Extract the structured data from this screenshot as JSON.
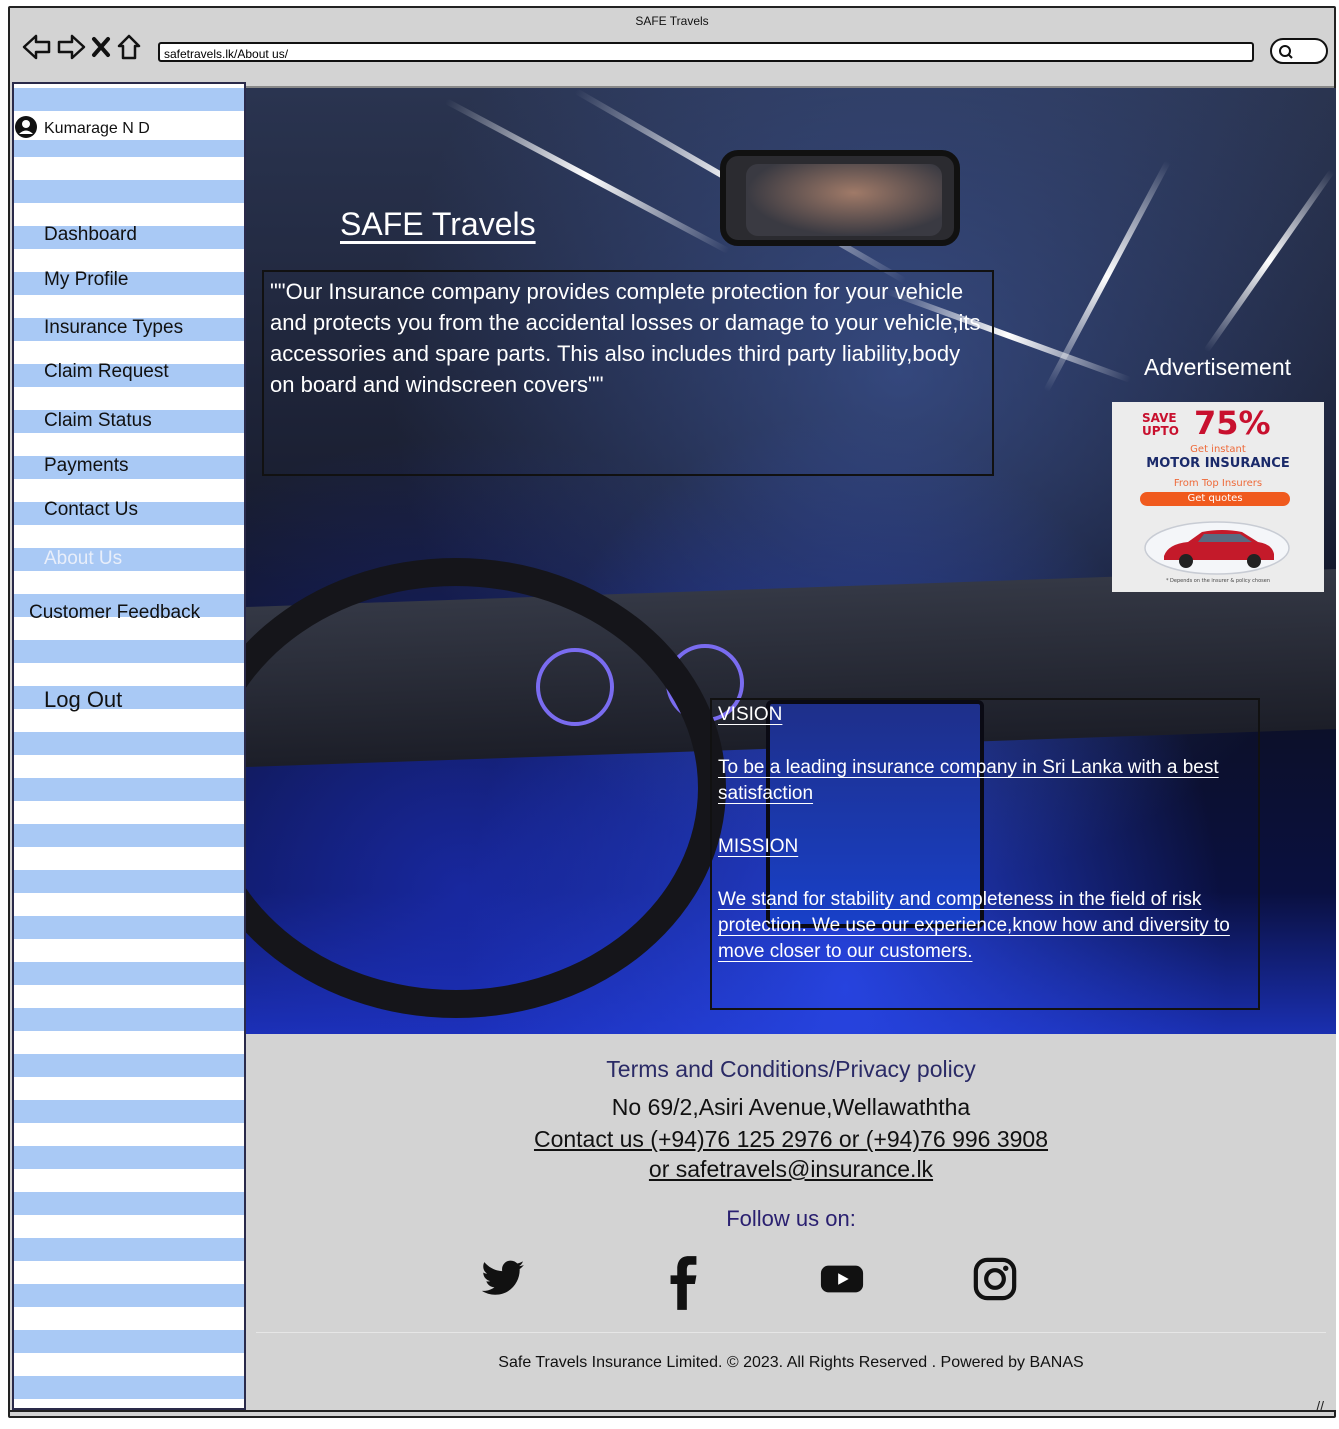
{
  "browser": {
    "title": "SAFE Travels",
    "url": "safetravels.lk/About us/",
    "icons": [
      "back-arrow-icon",
      "forward-arrow-icon",
      "close-icon",
      "home-icon",
      "search-icon"
    ]
  },
  "sidebar": {
    "user_name": "Kumarage N D",
    "items": [
      {
        "label": "Dashboard"
      },
      {
        "label": "My Profile"
      },
      {
        "label": "Insurance Types"
      },
      {
        "label": "Claim Request"
      },
      {
        "label": "Claim Status"
      },
      {
        "label": "Payments"
      },
      {
        "label": "Contact Us"
      },
      {
        "label": "About Us",
        "active": true
      },
      {
        "label": "Customer Feedback"
      },
      {
        "label": "Log Out"
      }
    ]
  },
  "hero": {
    "title": "SAFE Travels",
    "quote": "\"\"Our Insurance company provides complete protection for your vehicle and protects you from the accidental losses or damage to your vehicle,its accessories and spare parts. This also includes third party liability,body on board and windscreen covers\"\""
  },
  "advertisement": {
    "label": "Advertisement",
    "save": "SAVE",
    "upto": "UPTO",
    "percent": "75%",
    "instant": "Get instant",
    "motor": "MOTOR INSURANCE",
    "from": "From Top Insurers",
    "button": "Get quotes",
    "fineprint": "* Depends on the insurer & policy chosen"
  },
  "vision_mission": {
    "vision_heading": "VISION",
    "vision_text": "To be a leading insurance company in Sri Lanka with a best satisfaction",
    "mission_heading": "MISSION",
    "mission_text": "We stand for stability and completeness in the field of risk protection. We use our experience,know how and diversity to move closer to our customers."
  },
  "footer": {
    "terms": "Terms and Conditions/Privacy policy",
    "address": "No 69/2,Asiri Avenue,Wellawaththa",
    "contact": "Contact us (+94)76 125 2976 or (+94)76 996 3908",
    "email": "or  safetravels@insurance.lk",
    "follow": "Follow us on:",
    "social": [
      "twitter-icon",
      "facebook-icon",
      "youtube-icon",
      "instagram-icon"
    ],
    "copyright": "Safe Travels Insurance Limited. © 2023. All Rights Reserved . Powered by BANAS"
  },
  "colors": {
    "sidebar_stripe": "#a9c9f5",
    "footer_bg": "#d3d3d3",
    "terms_text": "#2a2a66",
    "follow_text": "#2a2070",
    "active_nav": "#e8eefa"
  }
}
